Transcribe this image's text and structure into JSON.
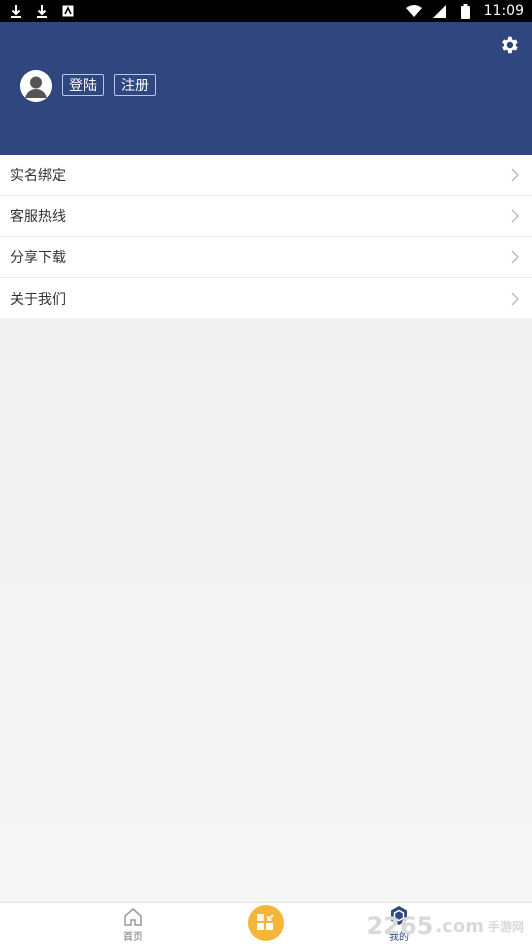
{
  "status_bar": {
    "time": "11:09",
    "icons": [
      "download-icon",
      "download-icon",
      "app-icon",
      "wifi-icon",
      "cellular-icon",
      "battery-icon"
    ]
  },
  "header": {
    "login_label": "登陆",
    "register_label": "注册",
    "accent": "#2f467e"
  },
  "menu": {
    "items": [
      {
        "label": "实名绑定"
      },
      {
        "label": "客服热线"
      },
      {
        "label": "分享下载"
      },
      {
        "label": "关于我们"
      }
    ]
  },
  "bottom_nav": {
    "home_label": "首页",
    "mine_label": "我的",
    "center_color": "#f3b63a"
  },
  "watermark": {
    "brand": "2265",
    "domain": ".com",
    "tag": "手游网"
  }
}
